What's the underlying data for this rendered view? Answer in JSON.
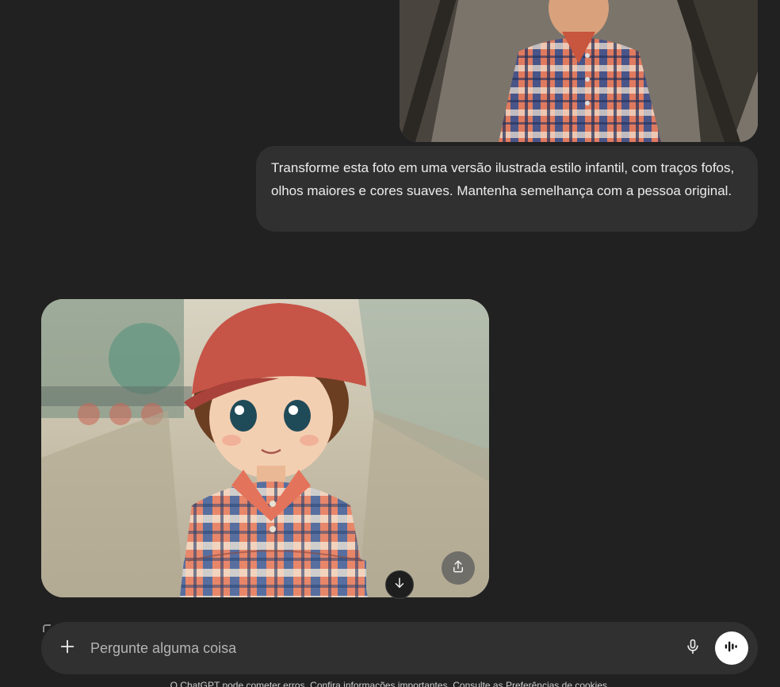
{
  "conversation": {
    "user_message": "Transforme esta foto em uma versão ilustrada estilo infantil, com traços fofos, olhos maiores e cores suaves. Mantenha semelhança com a pessoa original."
  },
  "composer": {
    "placeholder": "Pergunte alguma coisa"
  },
  "footer": {
    "disclaimer": "O ChatGPT pode cometer erros. Confira informações importantes. Consulte as Preferências de cookies."
  },
  "icons": {
    "add": "plus-icon",
    "mic": "microphone-icon",
    "voice": "voice-mode-icon",
    "share": "share-icon",
    "scroll_down": "arrow-down-icon"
  },
  "colors": {
    "background": "#212121",
    "bubble": "#303030",
    "composer": "#303030",
    "voice_button": "#ffffff"
  }
}
